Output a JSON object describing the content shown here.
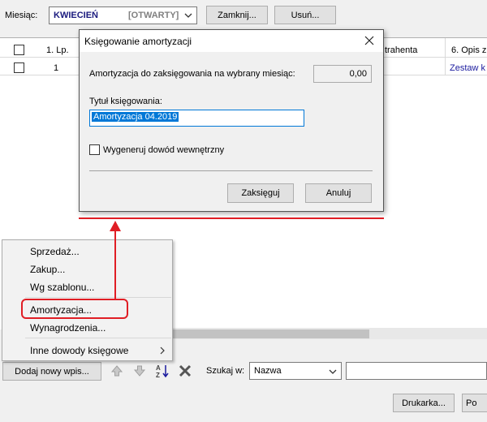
{
  "toolbar": {
    "month_label": "Miesiąc:",
    "month_value": "KWIECIEŃ",
    "month_status": "[OTWARTY]",
    "close_label": "Zamknij...",
    "delete_label": "Usuń..."
  },
  "grid": {
    "columns": [
      "",
      "1. Lp.",
      "trahenta",
      "6. Opis z"
    ],
    "rows": [
      {
        "lp": "1",
        "opis": "Zestaw k"
      }
    ]
  },
  "dialog": {
    "title": "Księgowanie amortyzacji",
    "amount_label": "Amortyzacja do zaksięgowania na wybrany miesiąc:",
    "amount_value": "0,00",
    "title_label": "Tytuł księgowania:",
    "title_value": "Amortyzacja 04.2019",
    "checkbox_label": "Wygeneruj dowód wewnętrzny",
    "post_label": "Zaksięguj",
    "cancel_label": "Anuluj"
  },
  "context_menu": {
    "items": [
      "Sprzedaż...",
      "Zakup...",
      "Wg szablonu...",
      "Amortyzacja...",
      "Wynagrodzenia...",
      "Inne dowody księgowe"
    ],
    "highlighted": "Amortyzacja..."
  },
  "bottom": {
    "add_label": "Dodaj nowy wpis...",
    "search_label": "Szukaj w:",
    "search_field": "Nazwa",
    "search_query": "",
    "print_label": "Drukarka...",
    "more_label": "Po"
  },
  "colors": {
    "annotation": "#e01e25",
    "selection": "#0078d7",
    "month_text": "#1a1a7e"
  },
  "icons": [
    "chevron-down-icon",
    "close-icon",
    "arrow-up-icon",
    "arrow-down-icon",
    "sort-az-icon",
    "delete-x-icon",
    "chevron-right-icon"
  ]
}
